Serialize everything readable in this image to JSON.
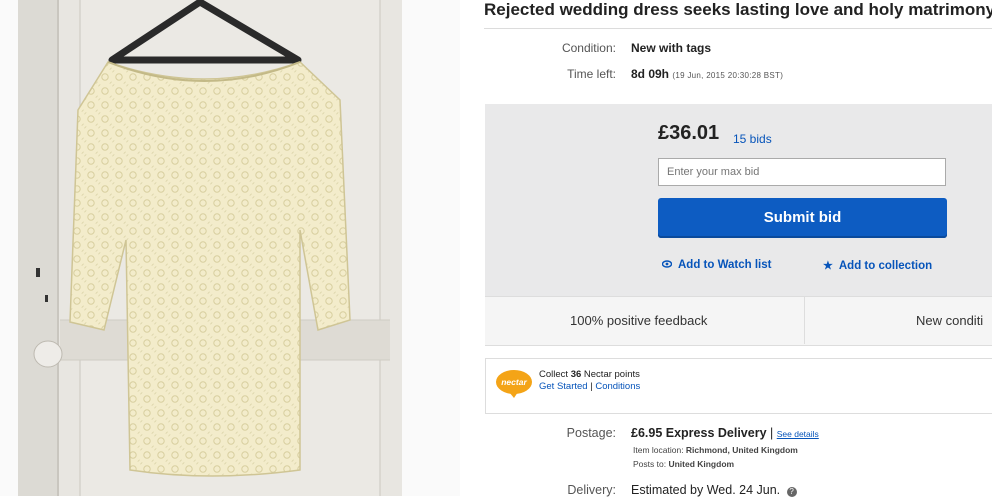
{
  "listing": {
    "title": "Rejected wedding dress seeks lasting love and holy matrimony",
    "condition_label": "Condition:",
    "condition_value": "New with tags",
    "time_left_label": "Time left:",
    "time_left_value": "8d 09h",
    "time_left_detail": "(19 Jun, 2015  20:30:28 BST)"
  },
  "bid": {
    "price": "£36.01",
    "bids": "15 bids",
    "max_bid_placeholder": "Enter your max bid",
    "submit_label": "Submit bid",
    "watch_label": "Add to Watch list",
    "collection_label": "Add to collection"
  },
  "seller": {
    "feedback": "100% positive feedback",
    "right_cell": "New conditi"
  },
  "nectar": {
    "logo_text": "nectar",
    "line1_prefix": "Collect ",
    "line1_points": "36",
    "line1_suffix": " Nectar points",
    "get_started": "Get Started",
    "separator": " | ",
    "conditions": "Conditions"
  },
  "shipping": {
    "postage_label": "Postage:",
    "postage_value": "£6.95  Express Delivery",
    "postage_sep": " | ",
    "see_details": "See details",
    "item_location_label": "Item location: ",
    "item_location_value": "Richmond, United Kingdom",
    "posts_to_label": "Posts to: ",
    "posts_to_value": "United Kingdom",
    "delivery_label": "Delivery:",
    "delivery_value": "Estimated by Wed. 24 Jun."
  },
  "icons": {
    "watch": "eye-icon",
    "collection": "star-icon",
    "info": "info-icon"
  },
  "colors": {
    "link": "#0654ba",
    "submit": "#0d5cc2",
    "bidbox": "#e9e9ea"
  }
}
